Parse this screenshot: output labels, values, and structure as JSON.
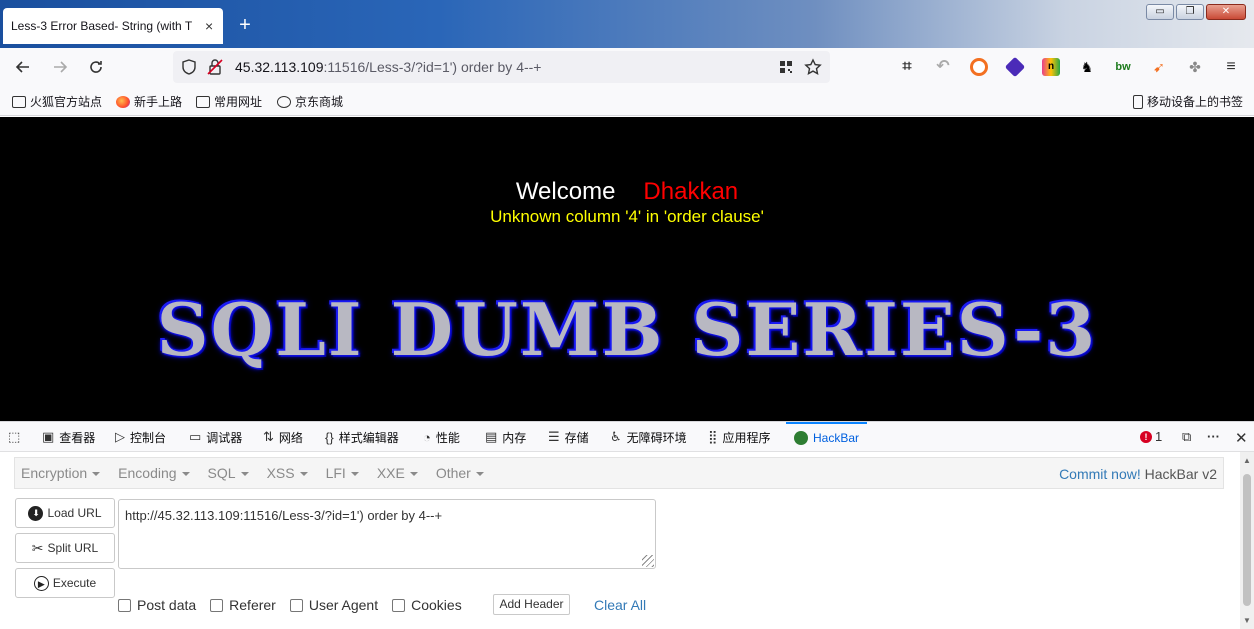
{
  "browser": {
    "tab_title": "Less-3 Error Based- String (with T",
    "tab_close": "×",
    "new_tab": "+",
    "window_controls": {
      "minimize": "▭",
      "restore": "❐",
      "close": "✕"
    },
    "url_host": "45.32.113.109",
    "url_rest": ":11516/Less-3/?id=1') order by 4--+",
    "bookmarks": [
      {
        "label": "火狐官方站点",
        "icon": "folder-icon"
      },
      {
        "label": "新手上路",
        "icon": "firefox-icon"
      },
      {
        "label": "常用网址",
        "icon": "folder-icon"
      },
      {
        "label": "京东商城",
        "icon": "globe-icon"
      }
    ],
    "mobile_bookmarks": "移动设备上的书签"
  },
  "page": {
    "welcome": "Welcome",
    "user": "Dhakkan",
    "error": "Unknown column '4' in 'order clause'",
    "banner": "SQLI DUMB SERIES-3",
    "colors": {
      "background": "#000000",
      "welcome": "#ffffff",
      "user": "#ff0000",
      "error": "#ffff00"
    }
  },
  "devtools": {
    "tabs": [
      {
        "label": "查看器",
        "icon": "inspector-icon"
      },
      {
        "label": "控制台",
        "icon": "console-icon"
      },
      {
        "label": "调试器",
        "icon": "debugger-icon"
      },
      {
        "label": "网络",
        "icon": "network-icon"
      },
      {
        "label": "样式编辑器",
        "icon": "style-editor-icon"
      },
      {
        "label": "性能",
        "icon": "performance-icon"
      },
      {
        "label": "内存",
        "icon": "memory-icon"
      },
      {
        "label": "存储",
        "icon": "storage-icon"
      },
      {
        "label": "无障碍环境",
        "icon": "accessibility-icon"
      },
      {
        "label": "应用程序",
        "icon": "application-icon"
      },
      {
        "label": "HackBar",
        "icon": "hackbar-icon",
        "active": true
      }
    ],
    "error_count": "1"
  },
  "hackbar": {
    "menu": [
      "Encryption",
      "Encoding",
      "SQL",
      "XSS",
      "LFI",
      "XXE",
      "Other"
    ],
    "commit_link": "Commit now!",
    "version": "HackBar v2",
    "load_url": "Load URL",
    "split_url": "Split URL",
    "execute": "Execute",
    "url_value": "http://45.32.113.109:11516/Less-3/?id=1') order by 4--+",
    "options": [
      "Post data",
      "Referer",
      "User Agent",
      "Cookies"
    ],
    "add_header": "Add Header",
    "clear_all": "Clear All"
  }
}
